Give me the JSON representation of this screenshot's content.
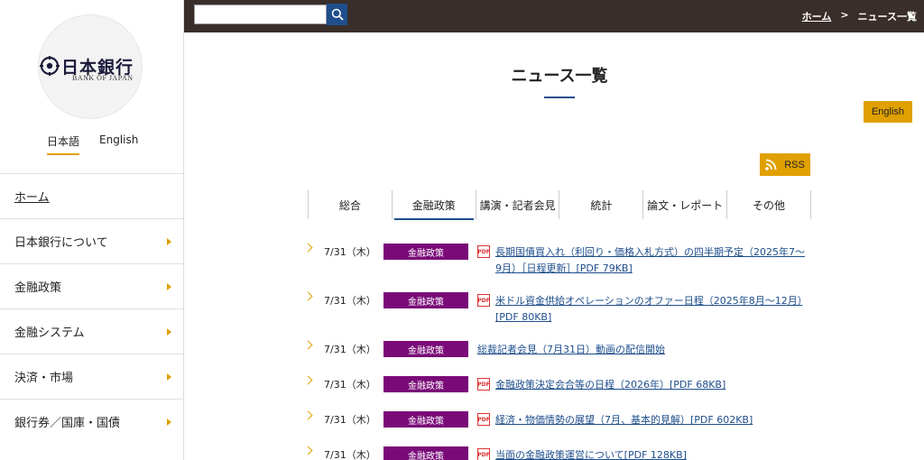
{
  "logo": {
    "text": "日本銀行",
    "subtitle": "BANK OF JAPAN"
  },
  "language": {
    "japanese": "日本語",
    "english": "English"
  },
  "nav": {
    "items": [
      {
        "label": "ホーム"
      },
      {
        "label": "日本銀行について"
      },
      {
        "label": "金融政策"
      },
      {
        "label": "金融システム"
      },
      {
        "label": "決済・市場"
      },
      {
        "label": "銀行券／国庫・国債"
      }
    ]
  },
  "search": {
    "placeholder": "",
    "icon": "search-icon"
  },
  "breadcrumb": {
    "home": "ホーム",
    "separator": ">",
    "current": "ニュース一覧"
  },
  "main": {
    "title": "ニュース一覧",
    "english_button": "English",
    "rss_label": "RSS"
  },
  "tabs": [
    {
      "label": "総合"
    },
    {
      "label": "金融政策"
    },
    {
      "label": "講演・記者会見"
    },
    {
      "label": "統計"
    },
    {
      "label": "論文・レポート"
    },
    {
      "label": "その他"
    }
  ],
  "news": [
    {
      "date": "7/31（木）",
      "category": "金融政策",
      "pdf": true,
      "title": "長期国債買入れ（利回り・価格入札方式）の四半期予定（2025年7〜9月）［日程更新］[PDF 79KB]"
    },
    {
      "date": "7/31（木）",
      "category": "金融政策",
      "pdf": true,
      "title": "米ドル資金供給オペレーションのオファー日程（2025年8月〜12月）[PDF 80KB]"
    },
    {
      "date": "7/31（木）",
      "category": "金融政策",
      "pdf": false,
      "title": "総裁記者会見（7月31日）動画の配信開始"
    },
    {
      "date": "7/31（木）",
      "category": "金融政策",
      "pdf": true,
      "title": "金融政策決定会合等の日程（2026年）[PDF 68KB]"
    },
    {
      "date": "7/31（木）",
      "category": "金融政策",
      "pdf": true,
      "title": "経済・物価情勢の展望（7月、基本的見解）[PDF 602KB]"
    },
    {
      "date": "7/31（木）",
      "category": "金融政策",
      "pdf": true,
      "title": "当面の金融政策運営について[PDF 128KB]"
    }
  ],
  "colors": {
    "topbar": "#3a2e2a",
    "accent": "#e0a000",
    "link": "#1e4e8c",
    "category": "#7a0a78"
  }
}
